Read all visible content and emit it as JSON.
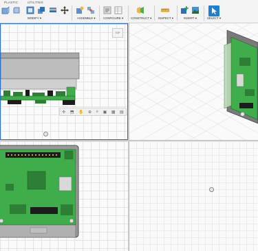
{
  "toolbar": {
    "tabs": [
      "PLASTIC",
      "UTILITIES"
    ],
    "groups": [
      {
        "label": "MODIFY ▾"
      },
      {
        "label": "ASSEMBLE ▾"
      },
      {
        "label": "CONFIGURE ▾"
      },
      {
        "label": "CONSTRUCT ▾"
      },
      {
        "label": "INSPECT ▾"
      },
      {
        "label": "INSERT ▾"
      },
      {
        "label": "SELECT ▾"
      }
    ]
  },
  "viewports": {
    "top_left": {
      "viewcube_label": "TOP"
    },
    "navbar": {
      "icons": [
        "orbit-icon",
        "pan-icon",
        "hand-icon",
        "zoom-icon",
        "fit-icon",
        "display-icon",
        "grid-icon",
        "viewports-icon"
      ]
    }
  },
  "colors": {
    "pcb_green": "#3fae4a",
    "pcb_dark": "#2e7f36",
    "case_gray": "#9a9a9a",
    "active_border": "#2a6fc9",
    "select_blue": "#1f7fd1"
  }
}
